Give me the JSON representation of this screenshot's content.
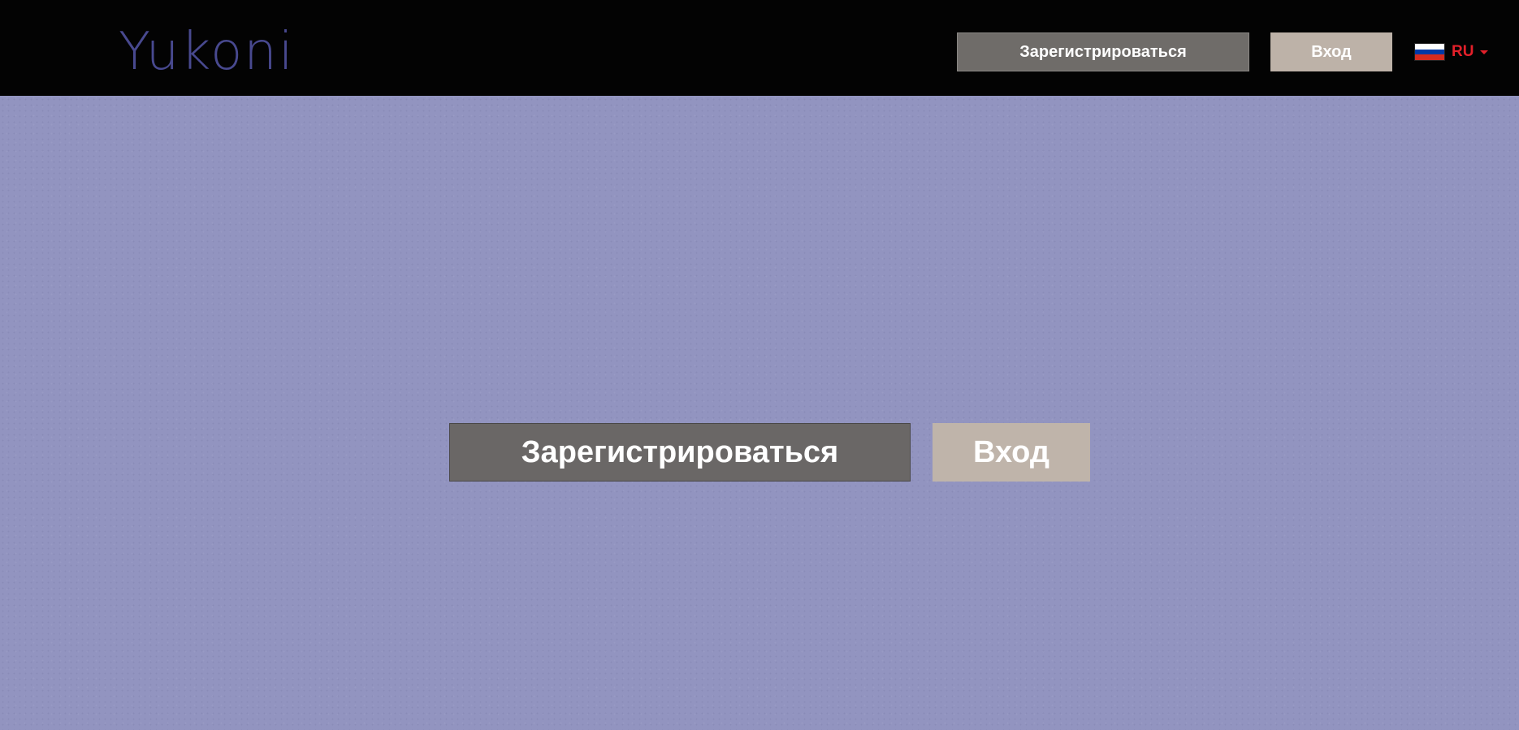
{
  "header": {
    "logo": "Yukoni",
    "register_label": "Зарегистрироваться",
    "login_label": "Вход",
    "language": {
      "code": "RU",
      "flag": "russia-flag-icon",
      "flag_colors": [
        "#ffffff",
        "#0039a6",
        "#d52b1e"
      ]
    }
  },
  "hero": {
    "register_label": "Зарегистрироваться",
    "login_label": "Вход"
  },
  "colors": {
    "header_bg": "#030303",
    "page_bg": "#9294c0",
    "logo": "#48498f",
    "register_bg": "#6f6c69",
    "login_bg": "#bdb2a8",
    "lang_accent": "#e3202a"
  }
}
